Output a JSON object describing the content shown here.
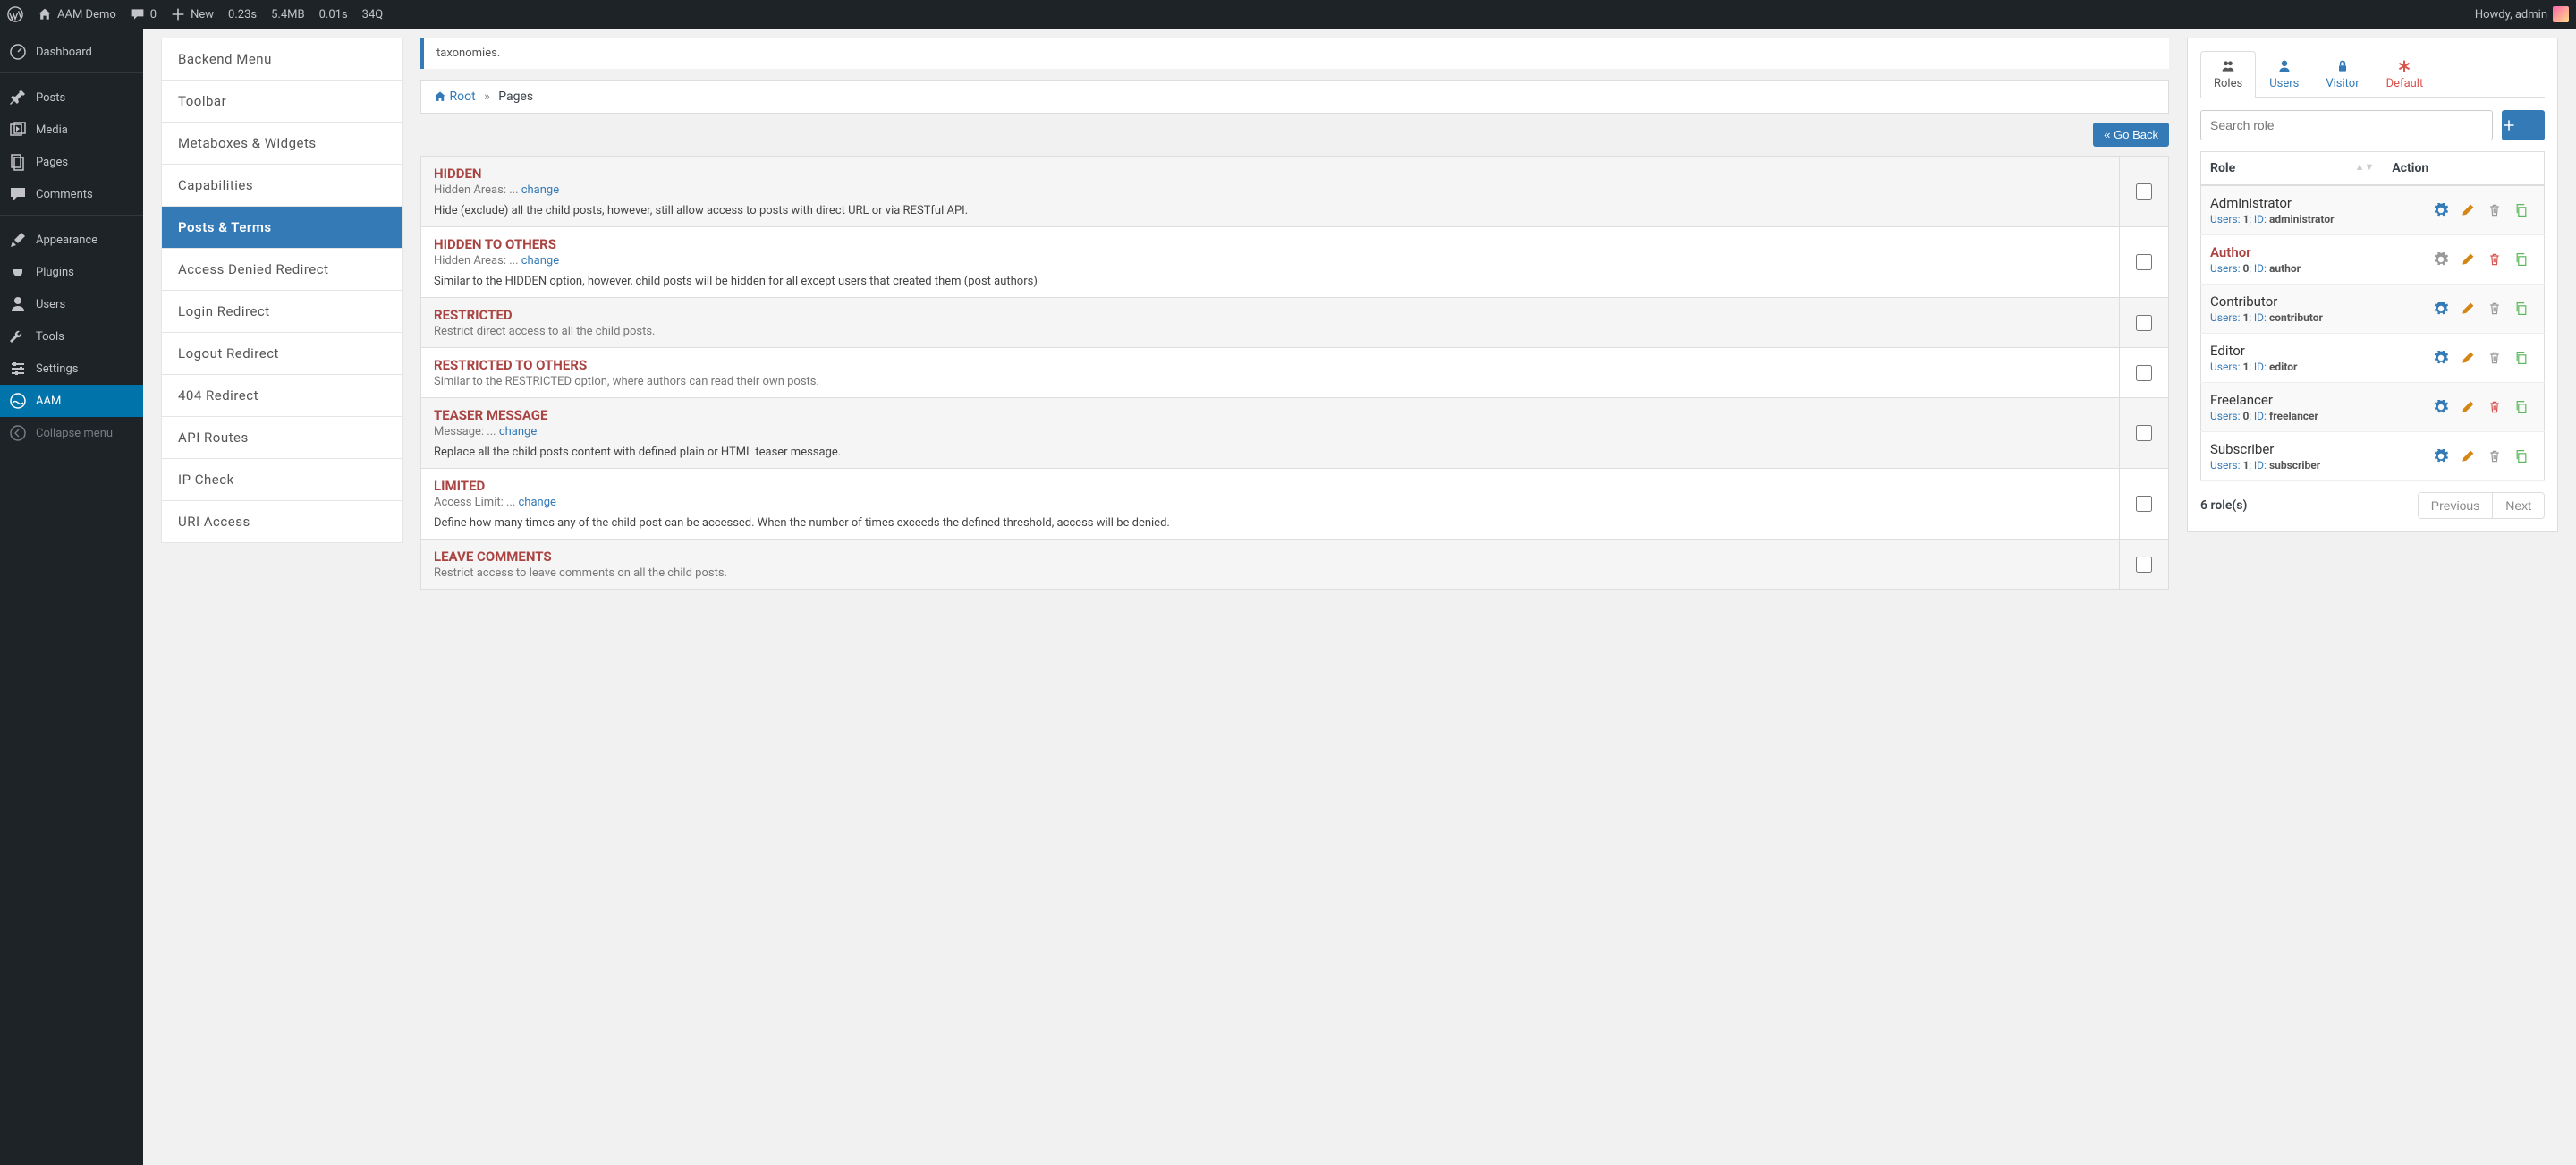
{
  "adminBar": {
    "siteName": "AAM Demo",
    "comments": "0",
    "new": "New",
    "stats": [
      "0.23s",
      "5.4MB",
      "0.01s",
      "34Q"
    ],
    "howdy": "Howdy, admin"
  },
  "wpMenu": [
    {
      "label": "Dashboard",
      "icon": "dashboard"
    },
    {
      "sep": true
    },
    {
      "label": "Posts",
      "icon": "pin"
    },
    {
      "label": "Media",
      "icon": "media"
    },
    {
      "label": "Pages",
      "icon": "page"
    },
    {
      "label": "Comments",
      "icon": "comment"
    },
    {
      "sep": true
    },
    {
      "label": "Appearance",
      "icon": "brush"
    },
    {
      "label": "Plugins",
      "icon": "plug"
    },
    {
      "label": "Users",
      "icon": "user"
    },
    {
      "label": "Tools",
      "icon": "wrench"
    },
    {
      "label": "Settings",
      "icon": "sliders"
    },
    {
      "label": "AAM",
      "icon": "aam",
      "active": true
    },
    {
      "label": "Collapse menu",
      "icon": "collapse",
      "collapse": true
    }
  ],
  "features": [
    "Backend Menu",
    "Toolbar",
    "Metaboxes & Widgets",
    "Capabilities",
    "Posts & Terms",
    "Access Denied Redirect",
    "Login Redirect",
    "Logout Redirect",
    "404 Redirect",
    "API Routes",
    "IP Check",
    "URI Access"
  ],
  "featureActive": "Posts & Terms",
  "info_tail": "taxonomies.",
  "breadcrumb": {
    "root": "Root",
    "current": "Pages"
  },
  "goBack": "« Go Back",
  "options": [
    {
      "title": "HIDDEN",
      "sub": "Hidden Areas: ...",
      "change": "change",
      "desc": "Hide (exclude) all the child posts, however, still allow access to posts with direct URL or via RESTful API."
    },
    {
      "title": "HIDDEN TO OTHERS",
      "sub": "Hidden Areas: ...",
      "change": "change",
      "desc": "Similar to the HIDDEN option, however, child posts will be hidden for all except users that created them (post authors)"
    },
    {
      "title": "RESTRICTED",
      "sub": "Restrict direct access to all the child posts."
    },
    {
      "title": "RESTRICTED TO OTHERS",
      "sub": "Similar to the RESTRICTED option, where authors can read their own posts."
    },
    {
      "title": "TEASER MESSAGE",
      "sub": "Message: ...",
      "change": "change",
      "desc": "Replace all the child posts content with defined plain or HTML teaser message."
    },
    {
      "title": "LIMITED",
      "sub": "Access Limit: ...",
      "change": "change",
      "desc": "Define how many times any of the child post can be accessed. When the number of times exceeds the defined threshold, access will be denied."
    },
    {
      "title": "LEAVE COMMENTS",
      "sub": "Restrict access to leave comments on all the child posts."
    }
  ],
  "tabs": {
    "roles": "Roles",
    "users": "Users",
    "visitor": "Visitor",
    "default": "Default"
  },
  "searchPlaceholder": "Search role",
  "roleTable": {
    "header": {
      "role": "Role",
      "action": "Action"
    },
    "rows": [
      {
        "name": "Administrator",
        "users": 1,
        "id": "administrator",
        "selected": false,
        "gearActive": true,
        "delDanger": false
      },
      {
        "name": "Author",
        "users": 0,
        "id": "author",
        "selected": true,
        "gearActive": false,
        "delDanger": true
      },
      {
        "name": "Contributor",
        "users": 1,
        "id": "contributor",
        "selected": false,
        "gearActive": true,
        "delDanger": false
      },
      {
        "name": "Editor",
        "users": 1,
        "id": "editor",
        "selected": false,
        "gearActive": true,
        "delDanger": false
      },
      {
        "name": "Freelancer",
        "users": 0,
        "id": "freelancer",
        "selected": false,
        "gearActive": true,
        "delDanger": true
      },
      {
        "name": "Subscriber",
        "users": 1,
        "id": "subscriber",
        "selected": false,
        "gearActive": true,
        "delDanger": false
      }
    ],
    "usersLabel": "Users",
    "idLabel": "ID",
    "count": "6 role(s)",
    "prev": "Previous",
    "next": "Next"
  }
}
